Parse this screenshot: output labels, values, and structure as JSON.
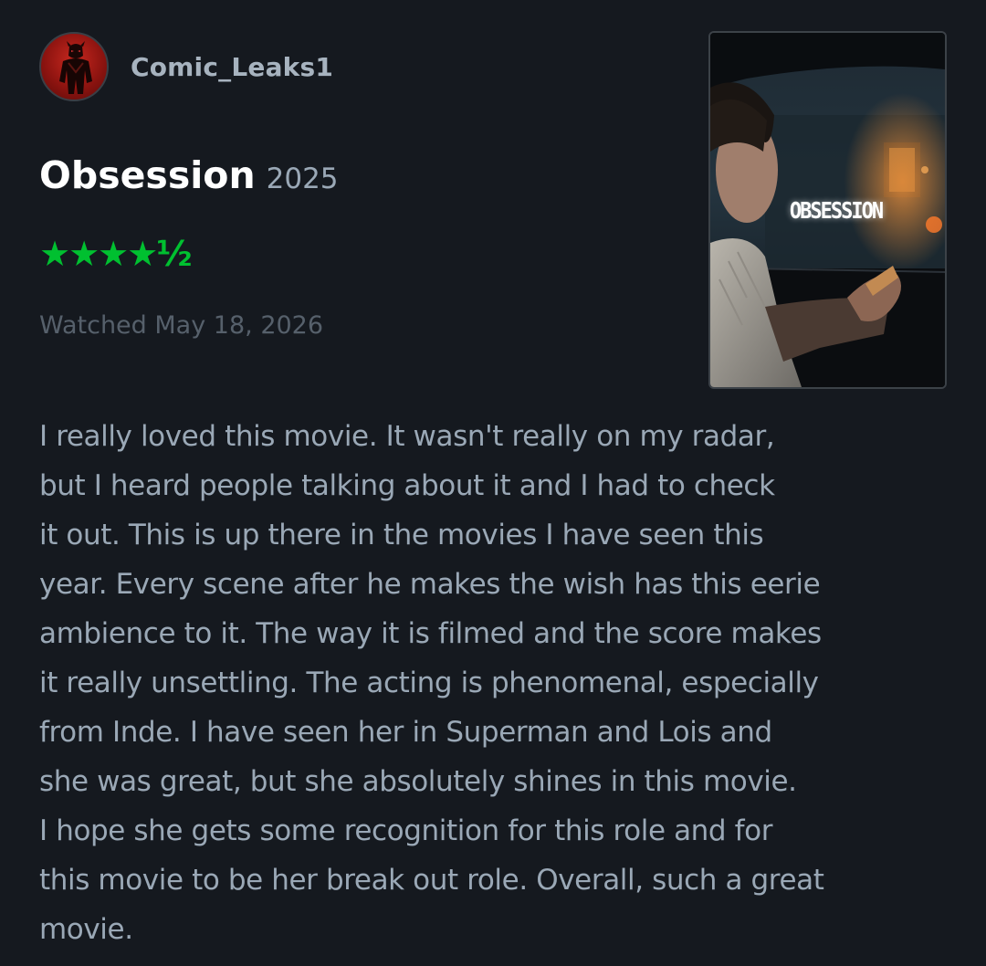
{
  "reviewer": {
    "username": "Comic_Leaks1",
    "avatar_icon": "masked-hero-avatar"
  },
  "film": {
    "title": "Obsession",
    "year": "2025",
    "poster_title": "OBSESSION"
  },
  "rating": {
    "stars_text": "★★★★½",
    "value": 4.5,
    "max": 5,
    "color": "#00c030"
  },
  "watched": {
    "text": "Watched May 18, 2026"
  },
  "review": {
    "lines": [
      "I really loved this movie. It wasn't really on my radar,",
      "but I heard people talking about it and I had to check",
      "it out. This is up there in the movies I have seen this",
      "year. Every scene after he makes the wish has this eerie",
      "ambience to it. The way it is filmed and the score makes",
      "it really unsettling. The acting is phenomenal, especially",
      "from Inde. I have seen her in Superman and Lois and",
      "she was great, but she absolutely shines in this movie.",
      "I hope she gets some recognition for this role and for",
      "this movie to be her break out role. Overall, such a great",
      "movie."
    ]
  },
  "colors": {
    "background": "#15191f",
    "accent_green": "#00c030",
    "text_primary": "#ffffff",
    "text_secondary": "#9aa8b6",
    "text_muted": "#56606b"
  }
}
